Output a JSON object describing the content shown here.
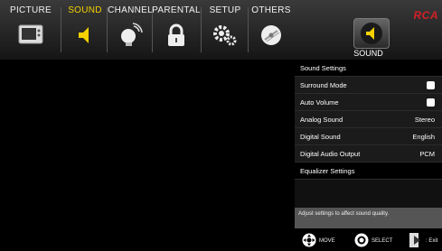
{
  "brand": "RCA",
  "tabs": [
    {
      "label": "PICTURE",
      "icon": "tv-icon",
      "active": false
    },
    {
      "label": "SOUND",
      "icon": "speaker-icon",
      "active": true
    },
    {
      "label": "CHANNEL",
      "icon": "satellite-icon",
      "active": false
    },
    {
      "label": "PARENTAL",
      "icon": "lock-icon",
      "active": false
    },
    {
      "label": "SETUP",
      "icon": "gears-icon",
      "active": false
    },
    {
      "label": "OTHERS",
      "icon": "disc-icon",
      "active": false
    }
  ],
  "panel": {
    "title": "SOUND",
    "header": "Sound Settings",
    "items": [
      {
        "label": "Surround Mode",
        "value": "",
        "type": "checkbox"
      },
      {
        "label": "Auto Volume",
        "value": "",
        "type": "checkbox"
      },
      {
        "label": "Analog Sound",
        "value": "Stereo",
        "type": "value"
      },
      {
        "label": "Digital Sound",
        "value": "English",
        "type": "value"
      },
      {
        "label": "Digital Audio Output",
        "value": "PCM",
        "type": "value"
      },
      {
        "label": "Equalizer Settings",
        "value": "",
        "type": "header"
      }
    ],
    "description": "Adjust settings to affect sound quality."
  },
  "footer": {
    "move": "MOVE",
    "select": "SELECT",
    "exit": ": Exit"
  },
  "colors": {
    "active_tab_text": "#f5d100",
    "brand": "#d41f26",
    "speaker_yellow": "#f5d100"
  }
}
